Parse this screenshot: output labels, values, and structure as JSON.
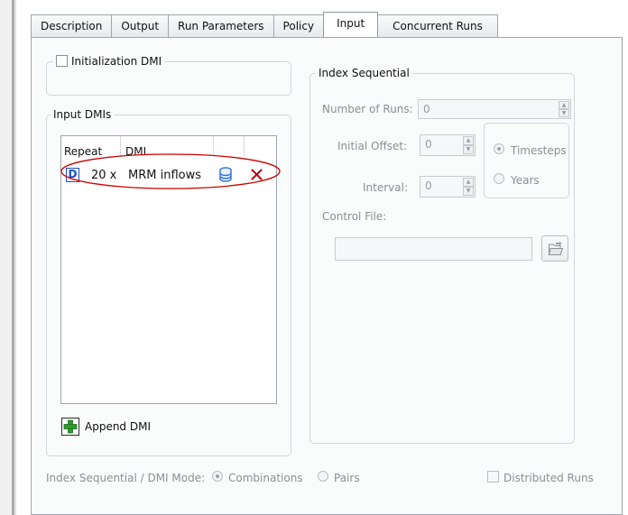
{
  "tabs": [
    "Description",
    "Output",
    "Run Parameters",
    "Policy",
    "Input",
    "Concurrent Runs"
  ],
  "active_tab": "Input",
  "init_dmi": {
    "label": "Initialization DMI",
    "checked": false
  },
  "input_dmis": {
    "title": "Input DMIs",
    "columns": {
      "repeat": "Repeat",
      "dmi": "DMI"
    },
    "rows": [
      {
        "badge": "D",
        "repeat": "20 x",
        "name": "MRM inflows"
      }
    ],
    "append_label": "Append DMI"
  },
  "index_sequential": {
    "title": "Index Sequential",
    "num_runs_label": "Number of Runs:",
    "num_runs_value": "0",
    "initial_offset_label": "Initial Offset:",
    "initial_offset_value": "0",
    "interval_label": "Interval:",
    "interval_value": "0",
    "timesteps_label": "Timesteps",
    "years_label": "Years",
    "control_file_label": "Control File:",
    "control_file_value": ""
  },
  "mode": {
    "label": "Index Sequential / DMI Mode:",
    "combinations_label": "Combinations",
    "pairs_label": "Pairs",
    "selected": "Combinations"
  },
  "distributed_runs": {
    "label": "Distributed Runs",
    "checked": false
  },
  "colors": {
    "annotation": "#cc0000",
    "badge": "#1a4fd0",
    "delete": "#b5121b",
    "plus": "#2e9b2e"
  }
}
